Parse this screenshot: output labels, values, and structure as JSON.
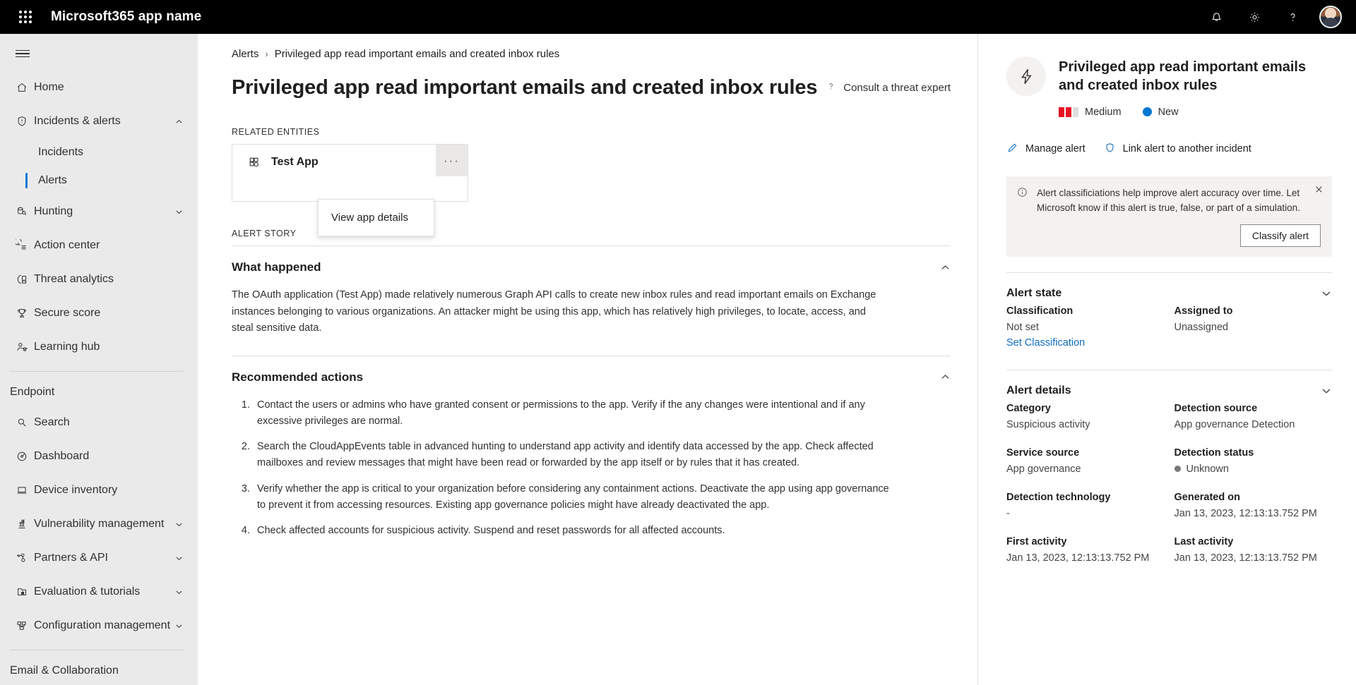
{
  "suitebar": {
    "waffle_icon": "waffle-grid-icon",
    "title": "Microsoft365 app name",
    "icons": [
      {
        "name": "notification-bell-icon",
        "glyph": "bell"
      },
      {
        "name": "settings-gear-icon",
        "glyph": "gear"
      },
      {
        "name": "help-question-icon",
        "glyph": "question"
      }
    ],
    "avatar_name": "user-avatar"
  },
  "sidebar": {
    "items": [
      {
        "label": "Home",
        "icon": "home-icon",
        "type": "item"
      },
      {
        "label": "Incidents & alerts",
        "icon": "shield-alert-icon",
        "type": "item",
        "chevron": "up"
      },
      {
        "label": "Incidents",
        "type": "sub"
      },
      {
        "label": "Alerts",
        "type": "sub",
        "selected": true
      },
      {
        "label": "Hunting",
        "icon": "hunting-icon",
        "type": "item",
        "chevron": "down"
      },
      {
        "label": "Action center",
        "icon": "action-center-icon",
        "type": "item"
      },
      {
        "label": "Threat analytics",
        "icon": "threat-analytics-icon",
        "type": "item"
      },
      {
        "label": "Secure score",
        "icon": "trophy-icon",
        "type": "item"
      },
      {
        "label": "Learning hub",
        "icon": "learning-hub-icon",
        "type": "item"
      }
    ],
    "group_endpoint": "Endpoint",
    "endpoint_items": [
      {
        "label": "Search",
        "icon": "search-icon"
      },
      {
        "label": "Dashboard",
        "icon": "dashboard-gauge-icon"
      },
      {
        "label": "Device inventory",
        "icon": "laptop-icon"
      },
      {
        "label": "Vulnerability management",
        "icon": "vulnerability-icon",
        "chevron": "down"
      },
      {
        "label": "Partners & API",
        "icon": "partners-api-icon",
        "chevron": "down"
      },
      {
        "label": "Evaluation & tutorials",
        "icon": "evaluation-icon",
        "chevron": "down"
      },
      {
        "label": "Configuration management",
        "icon": "configuration-icon",
        "chevron": "down"
      }
    ],
    "group_email": "Email & Collaboration"
  },
  "breadcrumb": {
    "root": "Alerts",
    "separator": "›",
    "current": "Privileged app read important emails and created inbox rules"
  },
  "page": {
    "title": "Privileged app read important emails and created inbox rules",
    "consult_expert": "Consult a threat expert",
    "related_entities_label": "RELATED ENTITIES",
    "entity": {
      "name": "Test App",
      "icon": "app-grid-icon",
      "ellipsis_label": "···"
    },
    "context_menu": {
      "items": [
        "View app details"
      ]
    },
    "alert_story_label": "ALERT STORY",
    "what_happened": {
      "title": "What happened",
      "body": "The OAuth application (Test App) made relatively numerous Graph API calls to create new inbox rules and read important emails on Exchange instances belonging to various organizations. An attacker might be using this app, which has relatively high privileges, to locate, access, and steal sensitive data."
    },
    "recommended_actions": {
      "title": "Recommended actions",
      "items": [
        "Contact the users or admins who have granted consent or permissions to the app. Verify if the any changes were intentional and if any excessive privileges are normal.",
        "Search the CloudAppEvents table in advanced hunting to understand app activity and identify data accessed by the app. Check affected mailboxes and review messages that might have been read or forwarded by the app itself or by rules that it has created.",
        "Verify whether the app is critical to your organization before considering any containment actions. Deactivate the app using app governance to prevent it from accessing resources. Existing app governance policies might have already deactivated the app.",
        "Check affected accounts for suspicious activity. Suspend and reset passwords for all affected accounts."
      ]
    }
  },
  "details": {
    "icon": "lightning-bolt-icon",
    "title": "Privileged app read important emails and created inbox rules",
    "severity": {
      "label": "Medium",
      "filled_bars": 2,
      "total_bars": 3,
      "color": "#e81123",
      "empty_color": "#e1dfdd"
    },
    "status": {
      "label": "New",
      "color": "#0078d4"
    },
    "actions": [
      {
        "label": "Manage alert",
        "icon": "pencil-icon"
      },
      {
        "label": "Link alert to another incident",
        "icon": "shield-link-icon"
      }
    ],
    "notice": {
      "icon": "info-icon",
      "text": "Alert classificiations help improve alert accuracy over time. Let Microsoft know if this alert is true, false, or part of a simulation.",
      "button": "Classify alert",
      "close_icon": "close-icon"
    },
    "alert_state": {
      "title": "Alert state",
      "chevron": "chevron-down-icon",
      "classification_key": "Classification",
      "classification_value": "Not set",
      "classification_link": "Set Classification",
      "assigned_key": "Assigned to",
      "assigned_value": "Unassigned"
    },
    "alert_details": {
      "title": "Alert details",
      "chevron": "chevron-down-icon",
      "fields": [
        {
          "key": "Category",
          "value": "Suspicious activity"
        },
        {
          "key": "Detection source",
          "value": "App governance Detection"
        },
        {
          "key": "Service source",
          "value": "App governance"
        },
        {
          "key": "Detection status",
          "value": "Unknown",
          "dot": true
        },
        {
          "key": "Detection technology",
          "value": "-"
        },
        {
          "key": "Generated on",
          "value": "Jan 13, 2023, 12:13:13.752 PM"
        },
        {
          "key": "First activity",
          "value": "Jan 13, 2023, 12:13:13.752 PM"
        },
        {
          "key": "Last activity",
          "value": "Jan 13, 2023, 12:13:13.752 PM"
        }
      ]
    }
  }
}
